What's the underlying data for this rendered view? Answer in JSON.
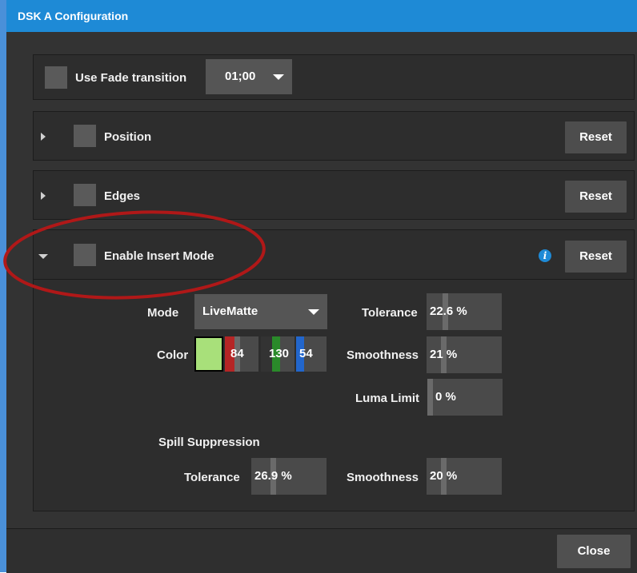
{
  "window": {
    "title": "DSK A Configuration"
  },
  "fade": {
    "checkbox_label": "Use Fade transition",
    "duration": "01;00"
  },
  "sections": {
    "position": {
      "label": "Position",
      "reset": "Reset"
    },
    "edges": {
      "label": "Edges",
      "reset": "Reset"
    },
    "insert": {
      "label": "Enable Insert Mode",
      "reset": "Reset",
      "info_icon": "info-icon"
    }
  },
  "insert_mode": {
    "mode_label": "Mode",
    "mode_value": "LiveMatte",
    "color_label": "Color",
    "color_swatch": "#a8e07a",
    "color_r": "84",
    "color_g": "130",
    "color_b": "54",
    "tolerance_label": "Tolerance",
    "tolerance_value": "22.6 %",
    "smoothness_label": "Smoothness",
    "smoothness_value": "21 %",
    "luma_label": "Luma Limit",
    "luma_value": "0 %"
  },
  "spill": {
    "title": "Spill Suppression",
    "tolerance_label": "Tolerance",
    "tolerance_value": "26.9 %",
    "smoothness_label": "Smoothness",
    "smoothness_value": "20 %"
  },
  "footer": {
    "close": "Close"
  },
  "colors": {
    "titlebar": "#1e8ad6",
    "annotation": "#b01818",
    "red": "#b52525",
    "green": "#2a8a2a",
    "blue": "#2266cc"
  }
}
